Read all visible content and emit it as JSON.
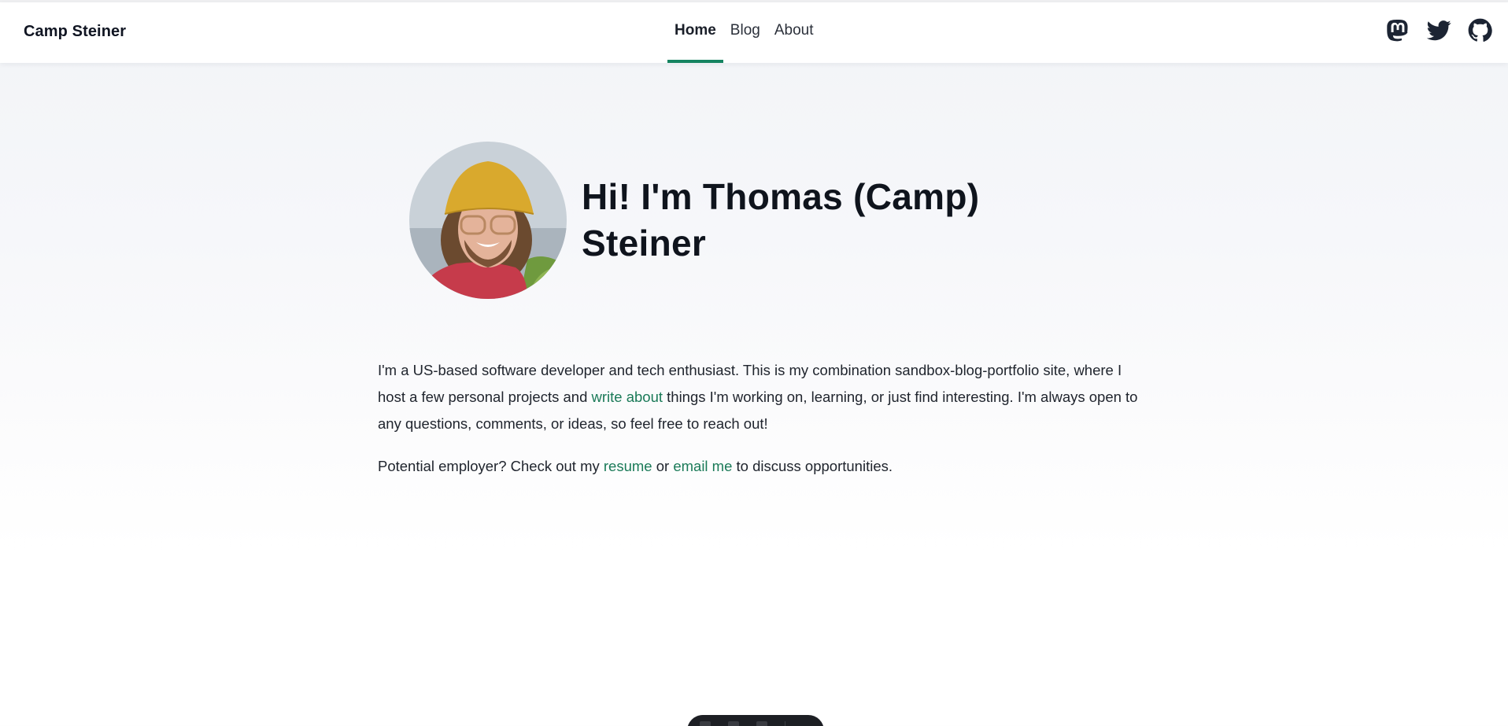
{
  "site": {
    "brand": "Camp Steiner"
  },
  "nav": {
    "items": [
      {
        "label": "Home",
        "active": true
      },
      {
        "label": "Blog",
        "active": false
      },
      {
        "label": "About",
        "active": false
      }
    ]
  },
  "social": [
    {
      "name": "Mastodon",
      "icon": "mastodon-icon"
    },
    {
      "name": "Twitter",
      "icon": "twitter-icon"
    },
    {
      "name": "GitHub",
      "icon": "github-icon"
    }
  ],
  "hero": {
    "avatar_alt": "Portrait of Thomas wearing a yellow bucket hat and glasses",
    "title": "Hi! I'm Thomas (Camp) Steiner"
  },
  "bio": {
    "p1_before": "I'm a US-based software developer and tech enthusiast. This is my combination sandbox-blog-portfolio site, where I host a few personal projects and ",
    "p1_link": "write about",
    "p1_after": " things I'm working on, learning, or just find interesting. I'm always open to any questions, comments, or ideas, so feel free to reach out!",
    "p2_before": "Potential employer? Check out my ",
    "p2_link1": "resume",
    "p2_middle": " or ",
    "p2_link2": "email me",
    "p2_after": " to discuss opportunities."
  },
  "colors": {
    "accent": "#158461",
    "link": "#1a7a58",
    "text": "#20252e",
    "heading": "#0f141d"
  }
}
